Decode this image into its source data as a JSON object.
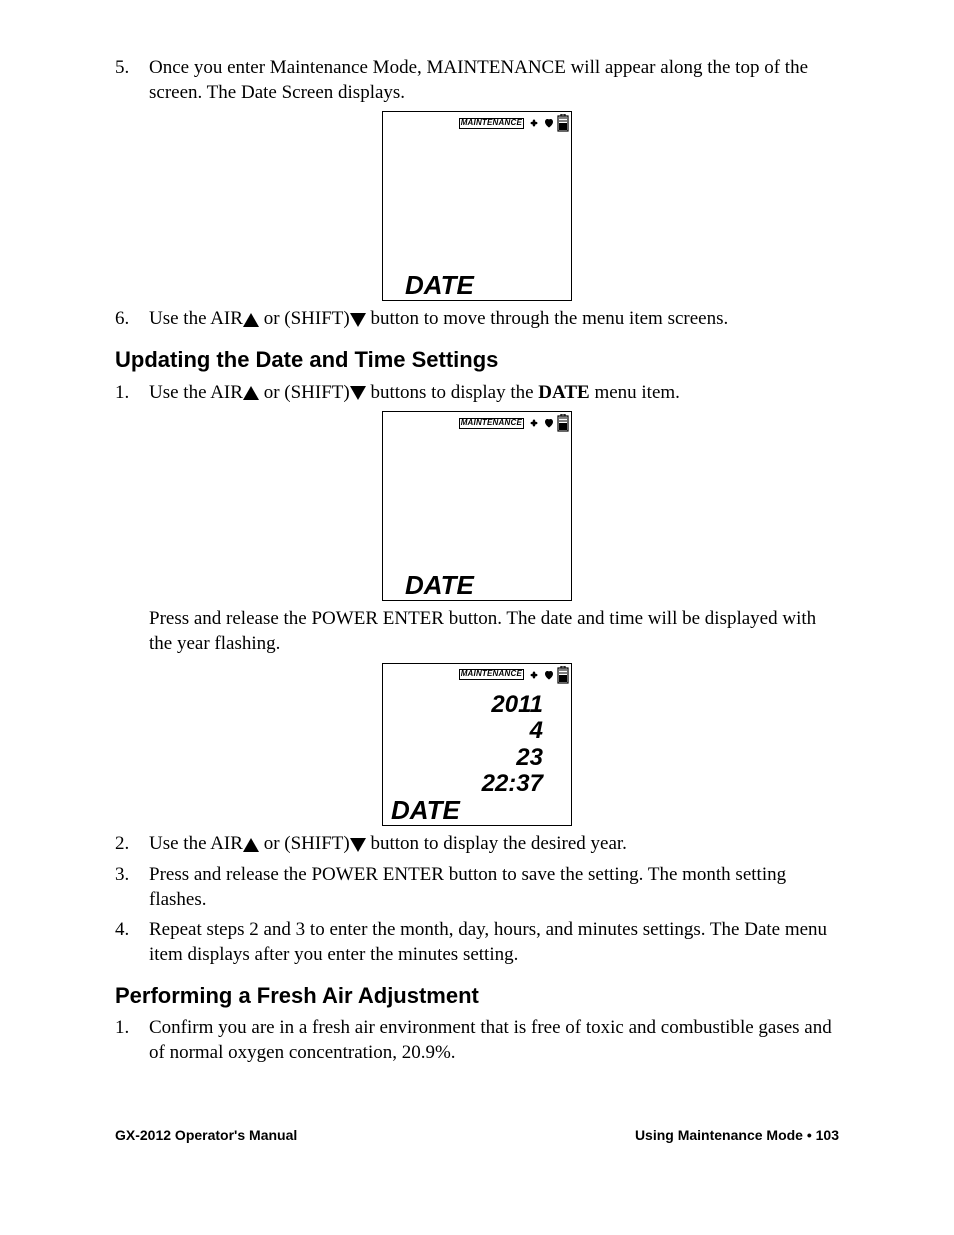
{
  "items": {
    "i5": {
      "num": "5.",
      "text": "Once you enter Maintenance Mode, MAINTENANCE will appear along the top of the screen. The Date Screen displays."
    },
    "i6": {
      "num": "6.",
      "pre": "Use the AIR",
      "mid": " or (SHIFT)",
      "post": " button to move through the menu item screens."
    }
  },
  "heading1": "Updating the Date and Time Settings",
  "sect1": {
    "i1": {
      "num": "1.",
      "pre": "Use the AIR",
      "mid": " or (SHIFT)",
      "post": " buttons to display the ",
      "bold": "DATE",
      "post2": " menu item."
    },
    "i1b": "Press and release the POWER ENTER button. The date and time will be displayed with the year flashing.",
    "i2": {
      "num": "2.",
      "pre": "Use the AIR",
      "mid": " or (SHIFT)",
      "post": " button to display the desired year."
    },
    "i3": {
      "num": "3.",
      "text": "Press and release the POWER ENTER button to save the setting. The month setting flashes."
    },
    "i4": {
      "num": "4.",
      "text": "Repeat steps 2 and 3 to enter the month, day, hours, and minutes settings. The Date menu item displays after you enter the minutes setting."
    }
  },
  "heading2": "Performing a Fresh Air Adjustment",
  "sect2": {
    "i1": {
      "num": "1.",
      "text": "Confirm you are in a fresh air environment that is free of toxic and combustible gases and of normal oxygen concentration, 20.9%."
    }
  },
  "screen": {
    "maint": "MAINTENANCE",
    "date": "DATE",
    "vals": {
      "year": "2011",
      "month": "4",
      "day": "23",
      "time": "22:37"
    }
  },
  "footer": {
    "left": "GX-2012 Operator's Manual",
    "right": "Using Maintenance Mode • 103"
  }
}
